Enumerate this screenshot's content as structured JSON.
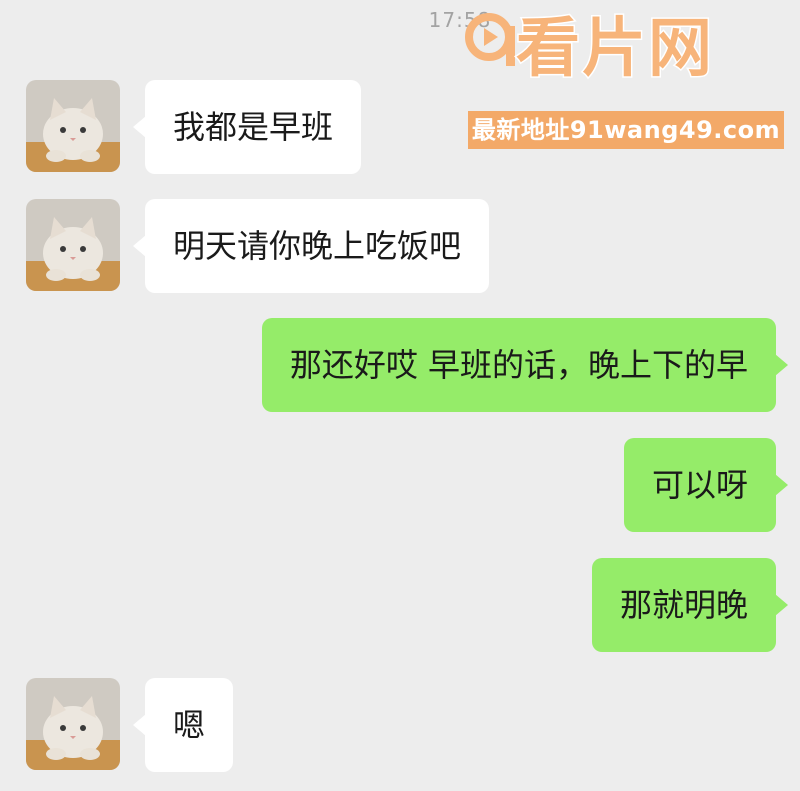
{
  "chat": {
    "timestamp": "17:58",
    "messages": [
      {
        "side": "in",
        "text": "我都是早班"
      },
      {
        "side": "in",
        "text": "明天请你晚上吃饭吧"
      },
      {
        "side": "out",
        "text": "那还好哎 早班的话，晚上下的早"
      },
      {
        "side": "out",
        "text": "可以呀"
      },
      {
        "side": "out",
        "text": "那就明晚"
      },
      {
        "side": "in",
        "text": "嗯"
      }
    ]
  },
  "avatar": {
    "icon": "cat-avatar-icon"
  },
  "watermark": {
    "title": "看片网",
    "url": "最新地址91wang49.com"
  },
  "colors": {
    "background": "#ededed",
    "incoming_bubble": "#ffffff",
    "outgoing_bubble": "#95ec69",
    "watermark": "#f3a968"
  }
}
